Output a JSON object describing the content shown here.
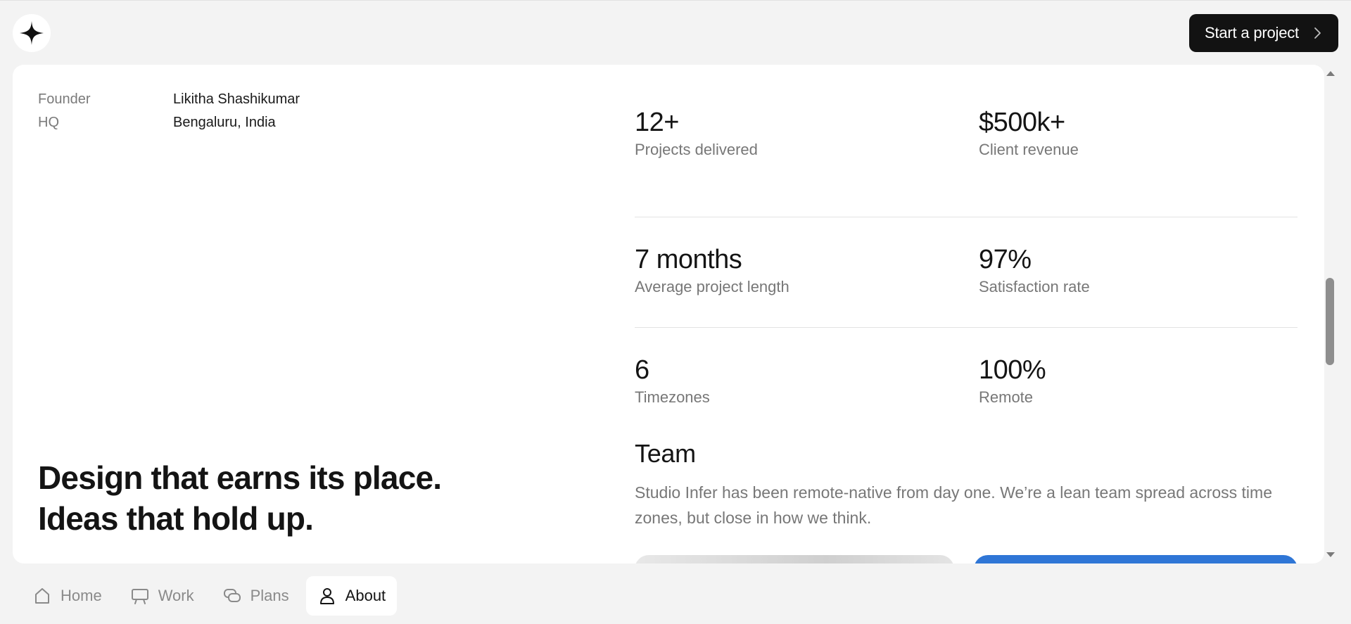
{
  "header": {
    "logo_icon": "four-point-star-icon",
    "cta_label": "Start a project"
  },
  "info": {
    "rows": [
      {
        "key": "Founder",
        "value": "Likitha Shashikumar"
      },
      {
        "key": "HQ",
        "value": "Bengaluru, India"
      }
    ]
  },
  "tagline": "Design that earns its place. Ideas that hold up.",
  "stats": [
    {
      "value": "12+",
      "label": "Projects delivered"
    },
    {
      "value": "$500k+",
      "label": "Client revenue"
    },
    {
      "value": "7 months",
      "label": "Average project length"
    },
    {
      "value": "97%",
      "label": "Satisfaction rate"
    },
    {
      "value": "6",
      "label": "Timezones"
    },
    {
      "value": "100%",
      "label": "Remote"
    }
  ],
  "team": {
    "title": "Team",
    "description": "Studio Infer has been remote-native from day one. We’re a lean team spread across time zones, but close in how we think."
  },
  "nav": {
    "items": [
      {
        "label": "Home",
        "icon": "home-icon"
      },
      {
        "label": "Work",
        "icon": "presentation-icon"
      },
      {
        "label": "Plans",
        "icon": "chat-bubbles-icon"
      },
      {
        "label": "About",
        "icon": "user-icon"
      }
    ],
    "active": "About"
  },
  "colors": {
    "background": "#f3f3f3",
    "card": "#ffffff",
    "cta_bg": "#121212",
    "accent_blue": "#2f76d6",
    "muted_text": "#777777"
  }
}
